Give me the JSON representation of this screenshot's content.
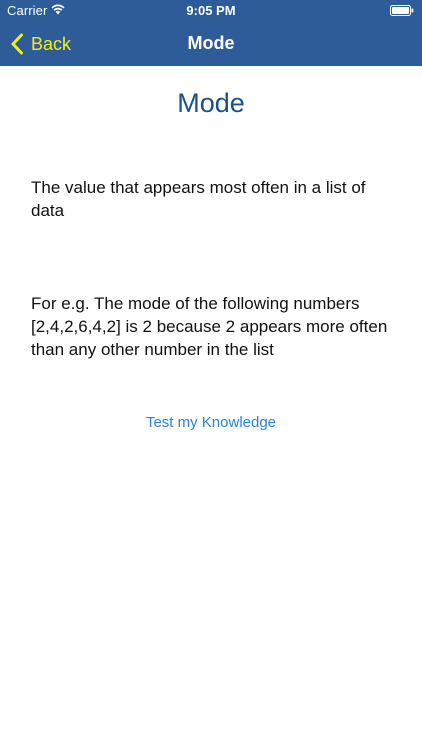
{
  "status_bar": {
    "carrier": "Carrier",
    "time": "9:05 PM"
  },
  "nav": {
    "back_label": "Back",
    "title": "Mode"
  },
  "main": {
    "heading": "Mode",
    "definition": "The value that appears most often in a list of data",
    "example": "For e.g. The mode of the following numbers [2,4,2,6,4,2] is 2 because 2 appears more often than any other number in the list",
    "test_link": "Test my Knowledge"
  },
  "colors": {
    "header_bg": "#2e5c98",
    "back_accent": "#f2ee1b",
    "heading_text": "#1f4f8b",
    "link_text": "#2a83d6"
  },
  "icons": [
    "wifi-icon",
    "battery-icon",
    "back-chevron-icon"
  ]
}
